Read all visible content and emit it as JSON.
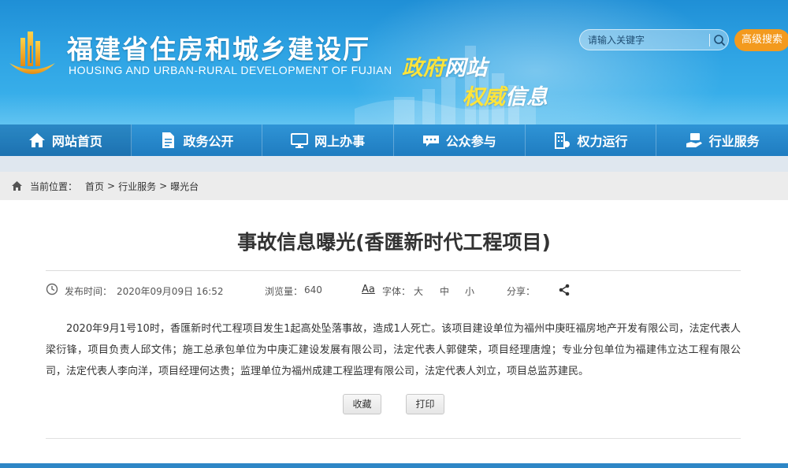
{
  "header": {
    "site_title": "福建省住房和城乡建设厅",
    "site_subtitle": "HOUSING AND URBAN-RURAL DEVELOPMENT OF FUJIAN",
    "slogan_line1_a": "政府",
    "slogan_line1_b": "网站",
    "slogan_line2_a": "权威",
    "slogan_line2_b": "信息",
    "search_placeholder": "请输入关键字",
    "advanced_search_label": "高级搜索"
  },
  "nav": {
    "items": [
      {
        "label": "网站首页",
        "icon": "home-icon"
      },
      {
        "label": "政务公开",
        "icon": "document-icon"
      },
      {
        "label": "网上办事",
        "icon": "monitor-icon"
      },
      {
        "label": "公众参与",
        "icon": "chat-icon"
      },
      {
        "label": "权力运行",
        "icon": "building-icon"
      },
      {
        "label": "行业服务",
        "icon": "hand-service-icon"
      }
    ]
  },
  "breadcrumb": {
    "prefix": "当前位置：",
    "items": [
      "首页",
      "行业服务",
      "曝光台"
    ],
    "separator": ">"
  },
  "article": {
    "title": "事故信息曝光(香匯新时代工程项目)",
    "publish_label": "发布时间：",
    "publish_time": "2020年09月09日 16:52",
    "views_label": "浏览量：",
    "views": "640",
    "font_icon_label": "Aa",
    "font_label": "字体：",
    "font_large": "大",
    "font_medium": "中",
    "font_small": "小",
    "share_label": "分享：",
    "body": "2020年9月1号10时，香匯新时代工程项目发生1起高处坠落事故，造成1人死亡。该项目建设单位为福州中庚旺福房地产开发有限公司，法定代表人梁衍锋，项目负责人邱文伟；施工总承包单位为中庚汇建设发展有限公司，法定代表人郭健荣，项目经理唐煌；专业分包单位为福建伟立达工程有限公司，法定代表人李向洋，项目经理何达贵；监理单位为福州成建工程监理有限公司，法定代表人刘立，项目总监苏建民。",
    "favorite_label": "收藏",
    "print_label": "打印"
  },
  "colors": {
    "banner_top": "#1f8fd6",
    "banner_bottom": "#3eb6ee",
    "nav": "#1f7cc0",
    "accent_orange": "#f39a1e",
    "slogan_yellow": "#ffe43a"
  }
}
